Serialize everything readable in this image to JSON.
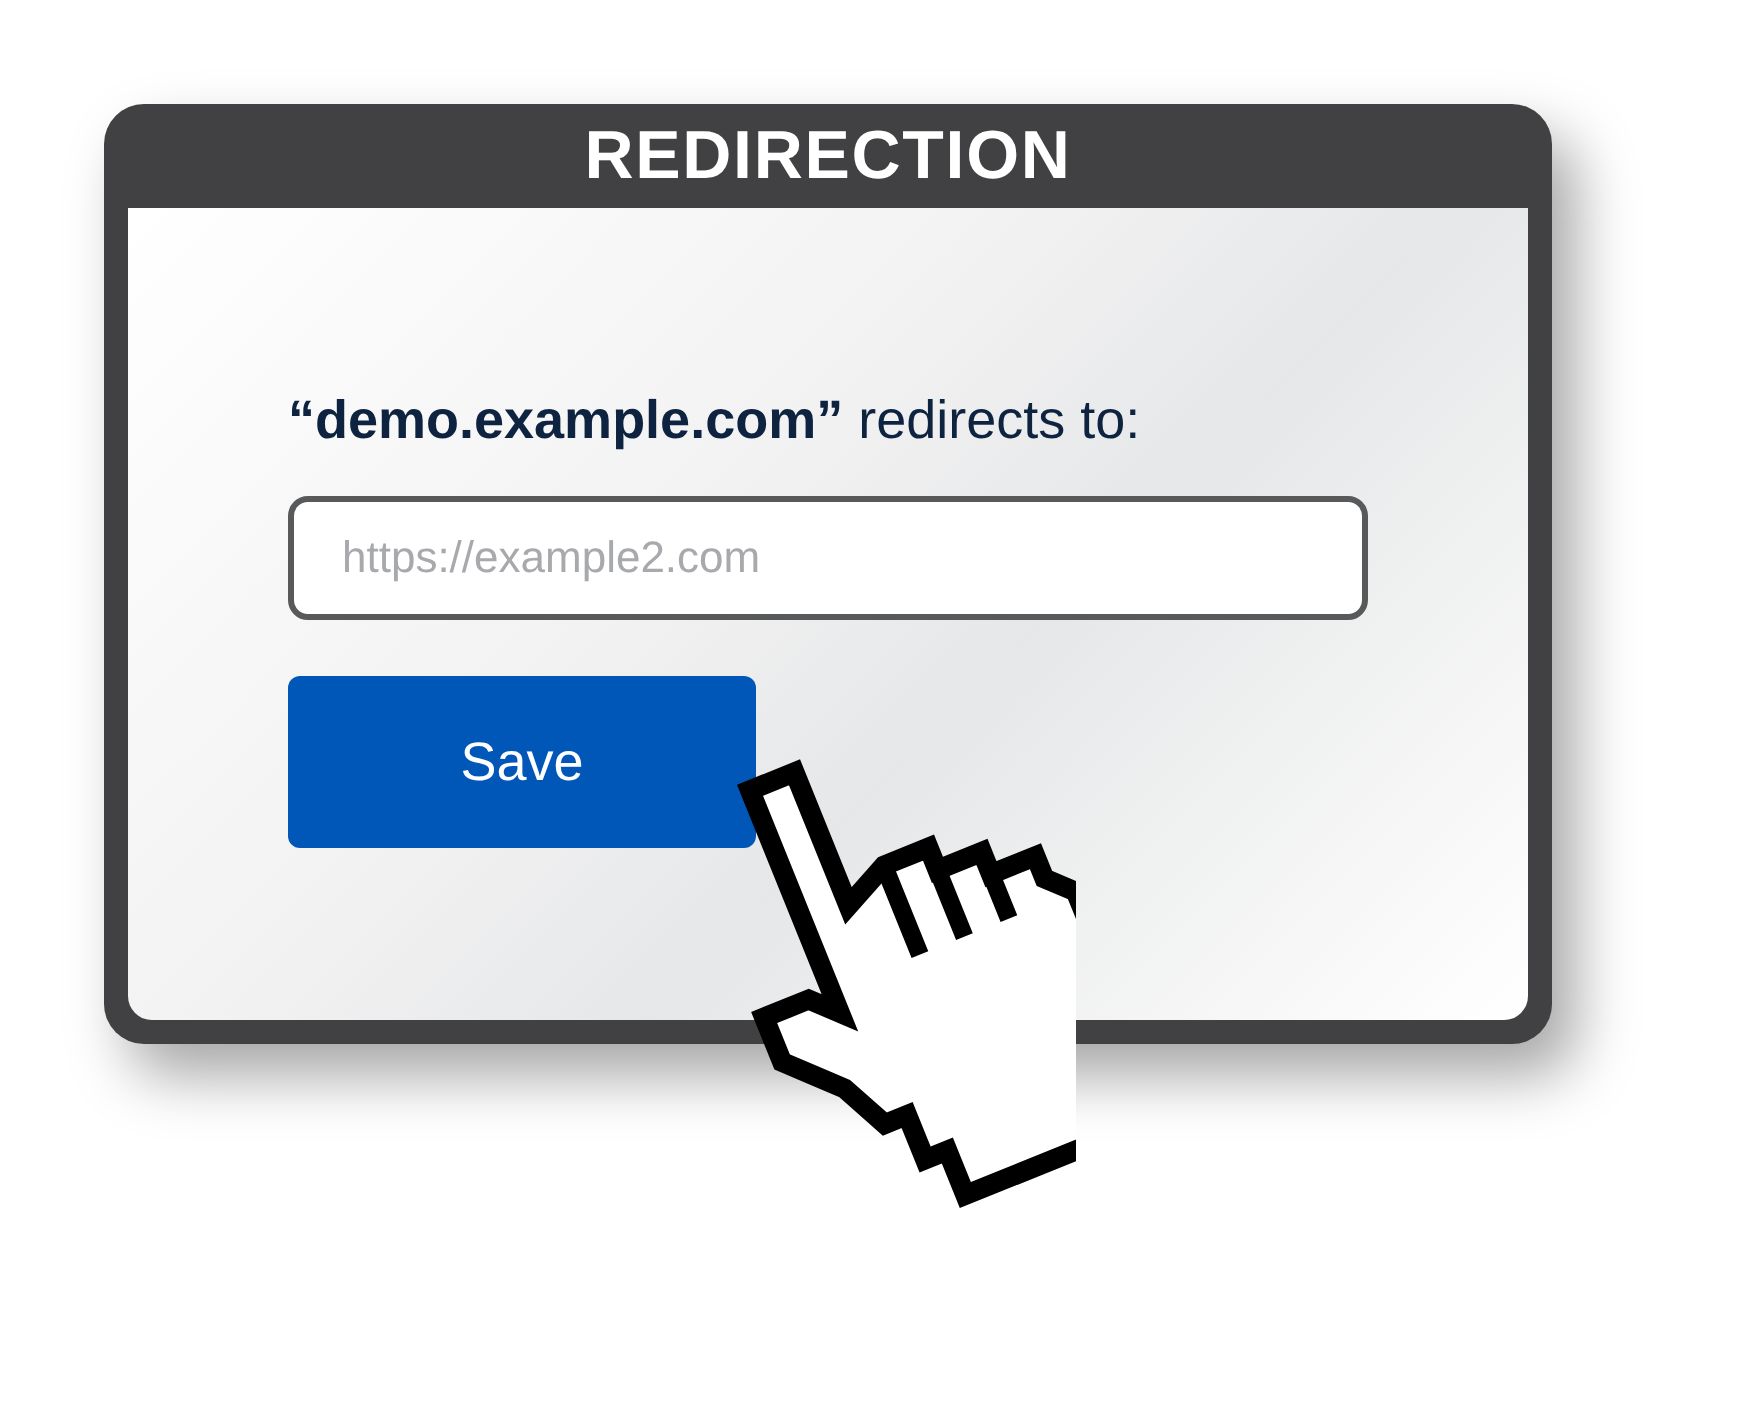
{
  "window": {
    "title": "REDIRECTION"
  },
  "prompt": "**“demo.example.com”** redirects to:",
  "url_field": {
    "placeholder": "https://example2.com"
  },
  "buttons": [
    {
      "label": "Save"
    }
  ]
}
